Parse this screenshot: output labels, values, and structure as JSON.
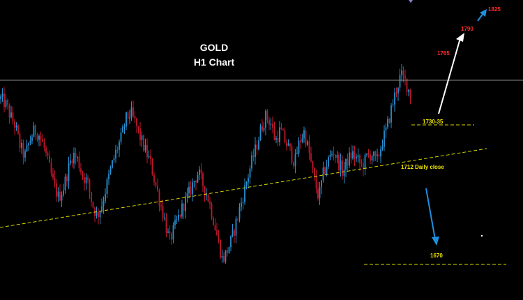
{
  "chart_data": {
    "type": "line",
    "title": "GOLD",
    "subtitle": "H1 Chart",
    "grid": false,
    "colors": {
      "background": "#000000",
      "bull_candle": "#2a8fd0",
      "bear_candle": "#c0182a",
      "trendline": "#d8d800",
      "resistance_line": "#8a8a8a",
      "arrow_up": "#ffffff",
      "arrow_down": "#1e90e0",
      "arrow_target": "#1e90e0",
      "label_yellow": "#f2e600",
      "label_red": "#ff2a2a"
    },
    "price_path": [
      1755,
      1752,
      1744,
      1738,
      1725,
      1718,
      1728,
      1735,
      1732,
      1724,
      1712,
      1700,
      1692,
      1698,
      1710,
      1720,
      1716,
      1706,
      1702,
      1688,
      1680,
      1688,
      1700,
      1712,
      1722,
      1730,
      1742,
      1746,
      1739,
      1730,
      1722,
      1715,
      1702,
      1690,
      1678,
      1664,
      1672,
      1680,
      1688,
      1694,
      1702,
      1708,
      1700,
      1692,
      1680,
      1666,
      1652,
      1658,
      1666,
      1678,
      1690,
      1702,
      1714,
      1724,
      1736,
      1744,
      1740,
      1728,
      1735,
      1728,
      1722,
      1714,
      1728,
      1734,
      1720,
      1704,
      1692,
      1708,
      1716,
      1722,
      1715,
      1708,
      1716,
      1720,
      1716,
      1712,
      1718,
      1720,
      1714,
      1726,
      1735,
      1748,
      1760,
      1770,
      1766,
      1758
    ],
    "annotations": [
      {
        "text": "1825",
        "color": "red"
      },
      {
        "text": "1790",
        "color": "red"
      },
      {
        "text": "1765",
        "color": "red"
      },
      {
        "text": "1730-35",
        "color": "yellow"
      },
      {
        "text": "1712 Daily close",
        "color": "yellow"
      },
      {
        "text": "1670",
        "color": "yellow"
      }
    ]
  }
}
